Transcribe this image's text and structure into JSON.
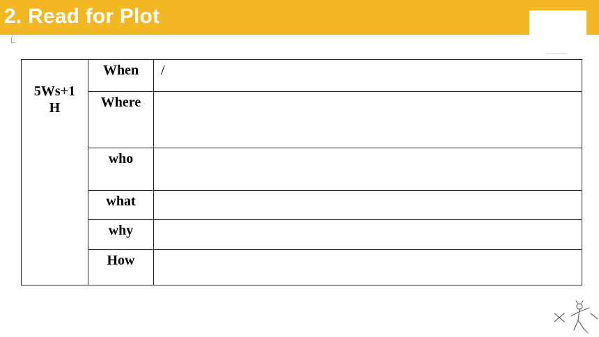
{
  "slide": {
    "title": "2. Read for Plot"
  },
  "table": {
    "group_label_line1": "5Ws+1",
    "group_label_line2": "H",
    "rows": [
      {
        "label": "When",
        "answer": "/"
      },
      {
        "label": "Where",
        "answer": ""
      },
      {
        "label": "who",
        "answer": ""
      },
      {
        "label": "what",
        "answer": ""
      },
      {
        "label": "why",
        "answer": ""
      },
      {
        "label": "How",
        "answer": ""
      }
    ]
  },
  "colors": {
    "title_bar": "#f2b722",
    "title_text": "#ffffff",
    "border": "#222222"
  },
  "icons": {
    "decoration": "stick-figure-doodle"
  }
}
